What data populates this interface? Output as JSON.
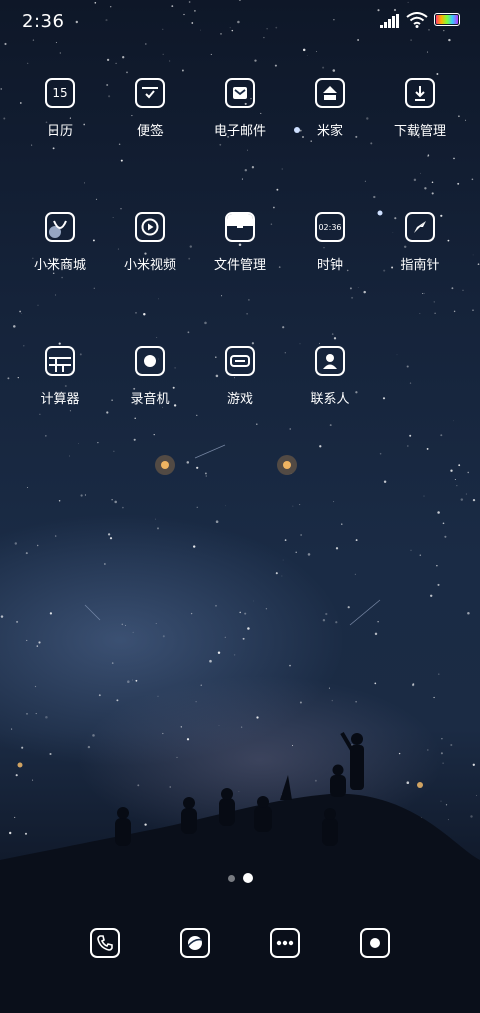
{
  "status_bar": {
    "time": "2:36",
    "icons": [
      "signal-icon",
      "wifi-icon",
      "battery-icon"
    ]
  },
  "apps": [
    {
      "label": "日历",
      "icon": "calendar-icon",
      "glyph": "15"
    },
    {
      "label": "便签",
      "icon": "notes-icon"
    },
    {
      "label": "电子邮件",
      "icon": "email-icon"
    },
    {
      "label": "米家",
      "icon": "home-icon"
    },
    {
      "label": "下载管理",
      "icon": "download-icon"
    },
    {
      "label": "小米商城",
      "icon": "shopping-bag-icon"
    },
    {
      "label": "小米视频",
      "icon": "video-play-icon"
    },
    {
      "label": "文件管理",
      "icon": "file-manager-icon"
    },
    {
      "label": "时钟",
      "icon": "clock-icon",
      "glyph": "02:36"
    },
    {
      "label": "指南针",
      "icon": "compass-icon"
    },
    {
      "label": "计算器",
      "icon": "calculator-icon"
    },
    {
      "label": "录音机",
      "icon": "recorder-icon"
    },
    {
      "label": "游戏",
      "icon": "game-icon"
    },
    {
      "label": "联系人",
      "icon": "contacts-icon"
    }
  ],
  "page_indicator": {
    "pages": 2,
    "current": 2
  },
  "dock": [
    "phone-icon",
    "browser-icon",
    "messages-icon",
    "camera-icon"
  ]
}
